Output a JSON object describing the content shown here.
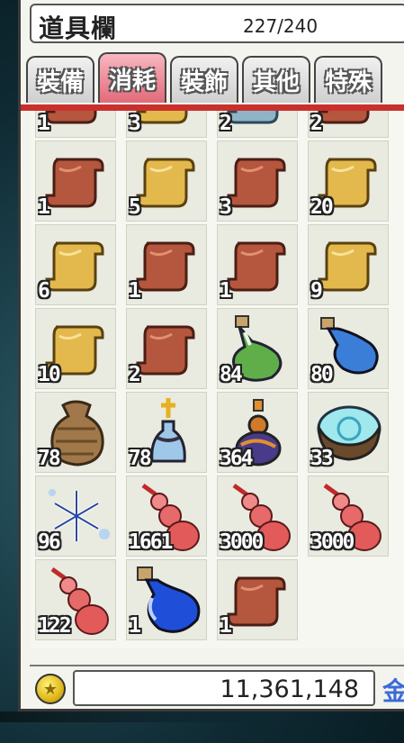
{
  "window": {
    "title": "道具欄",
    "capacity": "227/240"
  },
  "tabs": [
    {
      "label": "裝備",
      "active": false
    },
    {
      "label": "消耗",
      "active": true
    },
    {
      "label": "裝飾",
      "active": false
    },
    {
      "label": "其他",
      "active": false
    },
    {
      "label": "特殊",
      "active": false
    }
  ],
  "items": [
    {
      "icon": "red-scroll-icon",
      "count": "1"
    },
    {
      "icon": "yellow-scroll-icon",
      "count": "3"
    },
    {
      "icon": "blue-scroll-icon",
      "count": "2"
    },
    {
      "icon": "red-scroll-icon",
      "count": "2"
    },
    {
      "icon": "red-scroll-icon",
      "count": "1"
    },
    {
      "icon": "yellow-scroll-icon",
      "count": "5"
    },
    {
      "icon": "red-scroll-icon",
      "count": "3"
    },
    {
      "icon": "yellow-scroll-icon",
      "count": "20"
    },
    {
      "icon": "yellow-scroll-icon",
      "count": "6"
    },
    {
      "icon": "red-scroll-icon",
      "count": "1"
    },
    {
      "icon": "red-scroll-icon",
      "count": "1"
    },
    {
      "icon": "yellow-scroll-icon",
      "count": "9"
    },
    {
      "icon": "yellow-scroll-icon",
      "count": "10"
    },
    {
      "icon": "red-scroll-icon",
      "count": "2"
    },
    {
      "icon": "green-potion-icon",
      "count": "84"
    },
    {
      "icon": "blue-potion-icon",
      "count": "80"
    },
    {
      "icon": "sack-icon",
      "count": "78"
    },
    {
      "icon": "cross-bottle-icon",
      "count": "78"
    },
    {
      "icon": "purple-elixir-icon",
      "count": "364"
    },
    {
      "icon": "magic-stone-icon",
      "count": "33"
    },
    {
      "icon": "snowflake-icon",
      "count": "96"
    },
    {
      "icon": "red-gourd-icon",
      "count": "1661"
    },
    {
      "icon": "red-gourd-icon",
      "count": "3000"
    },
    {
      "icon": "red-gourd-icon",
      "count": "3000"
    },
    {
      "icon": "red-gourd-icon",
      "count": "122"
    },
    {
      "icon": "blue-bottle-icon",
      "count": "1"
    },
    {
      "icon": "red-scroll-icon",
      "count": "1"
    },
    {
      "icon": "",
      "count": ""
    }
  ],
  "money": {
    "value": "11,361,148",
    "button_label": "金"
  },
  "colors": {
    "active_tab": "#e26a7a",
    "tab_strip": "#c9302c",
    "red_scroll": "#b5563e",
    "yellow_scroll": "#e3b94d",
    "blue_scroll": "#8fb4c6"
  }
}
